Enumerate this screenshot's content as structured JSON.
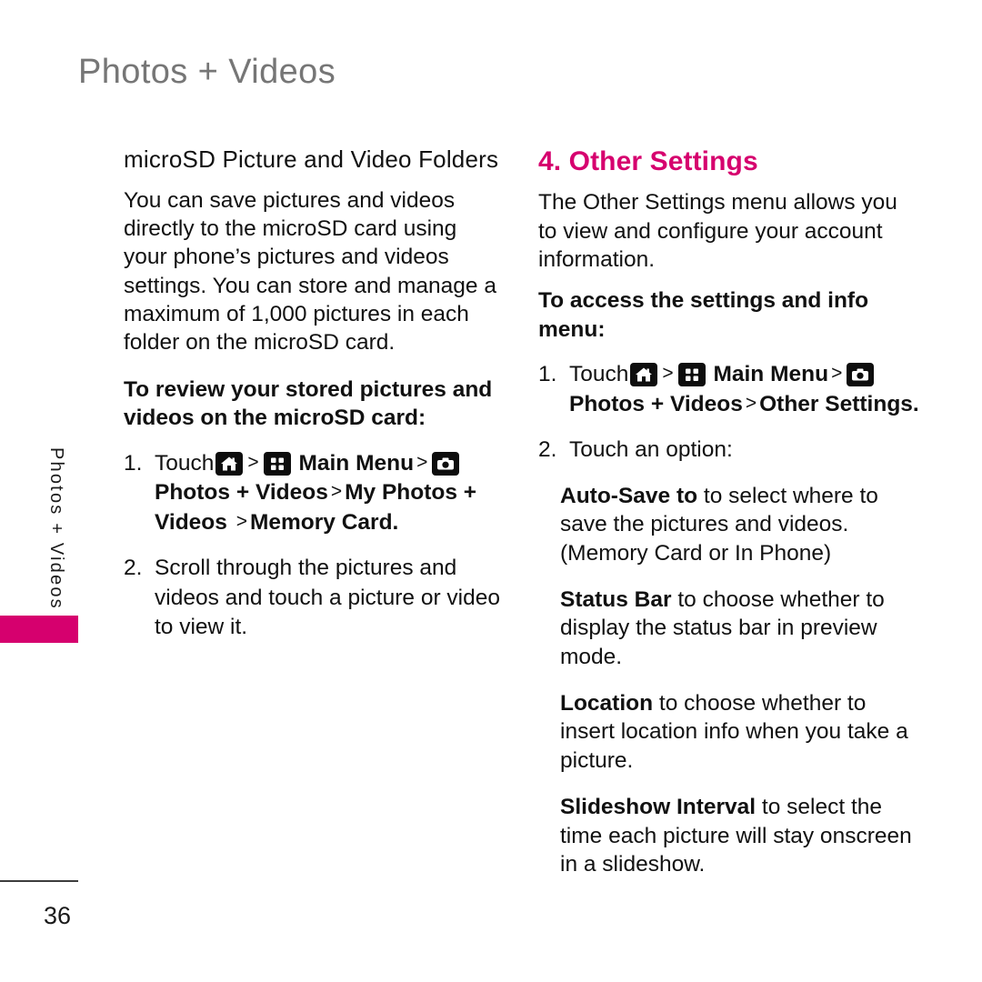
{
  "header": {
    "title": "Photos + Videos"
  },
  "side_tab": {
    "label": "Photos + Videos",
    "accent_color": "#d6006e"
  },
  "left_column": {
    "section_heading": "microSD Picture and Video Folders",
    "intro_paragraph": "You can save pictures and videos directly to the microSD card using your phone’s pictures and videos settings. You can store and manage a maximum of 1,000 pictures in each folder on the microSD card.",
    "lead_bold": "To review your stored pictures and videos on the microSD card:",
    "steps": [
      {
        "number": "1.",
        "touch_label": "Touch",
        "icon_home": "home-icon",
        "sep1": ">",
        "icon_grid": "grid-icon",
        "main_menu_label": "Main Menu",
        "sep2": ">",
        "icon_camera": "camera-icon",
        "trail_bold_1": "Photos + Videos",
        "sep3": ">",
        "trail_bold_2": "My Photos + Videos",
        "sep4": ">",
        "trail_bold_3": "Memory Card."
      },
      {
        "number": "2.",
        "text": "Scroll through the pictures and videos and touch a picture or video to view it."
      }
    ]
  },
  "right_column": {
    "section_heading": "4. Other Settings",
    "intro_paragraph": "The Other Settings menu allows you to view and configure your account information.",
    "lead_bold": "To access the settings and info menu:",
    "steps": [
      {
        "number": "1.",
        "touch_label": "Touch",
        "icon_home": "home-icon",
        "sep1": ">",
        "icon_grid": "grid-icon",
        "main_menu_label": "Main Menu",
        "sep2": ">",
        "icon_camera": "camera-icon",
        "trail_bold_1": "Photos + Videos",
        "sep3": ">",
        "trail_bold_2": "Other Settings."
      },
      {
        "number": "2.",
        "text": "Touch an option:"
      }
    ],
    "options": [
      {
        "name": "Auto-Save to",
        "description": " to select where to save the pictures and videos. (Memory Card or In Phone)"
      },
      {
        "name": "Status Bar",
        "description": " to choose whether to display the status  bar in preview mode."
      },
      {
        "name": "Location",
        "description": " to choose whether to insert location info when you take a picture."
      },
      {
        "name": "Slideshow Interval",
        "description": " to select the time each picture will stay onscreen in a slideshow."
      }
    ]
  },
  "footer": {
    "page_number": "36"
  }
}
